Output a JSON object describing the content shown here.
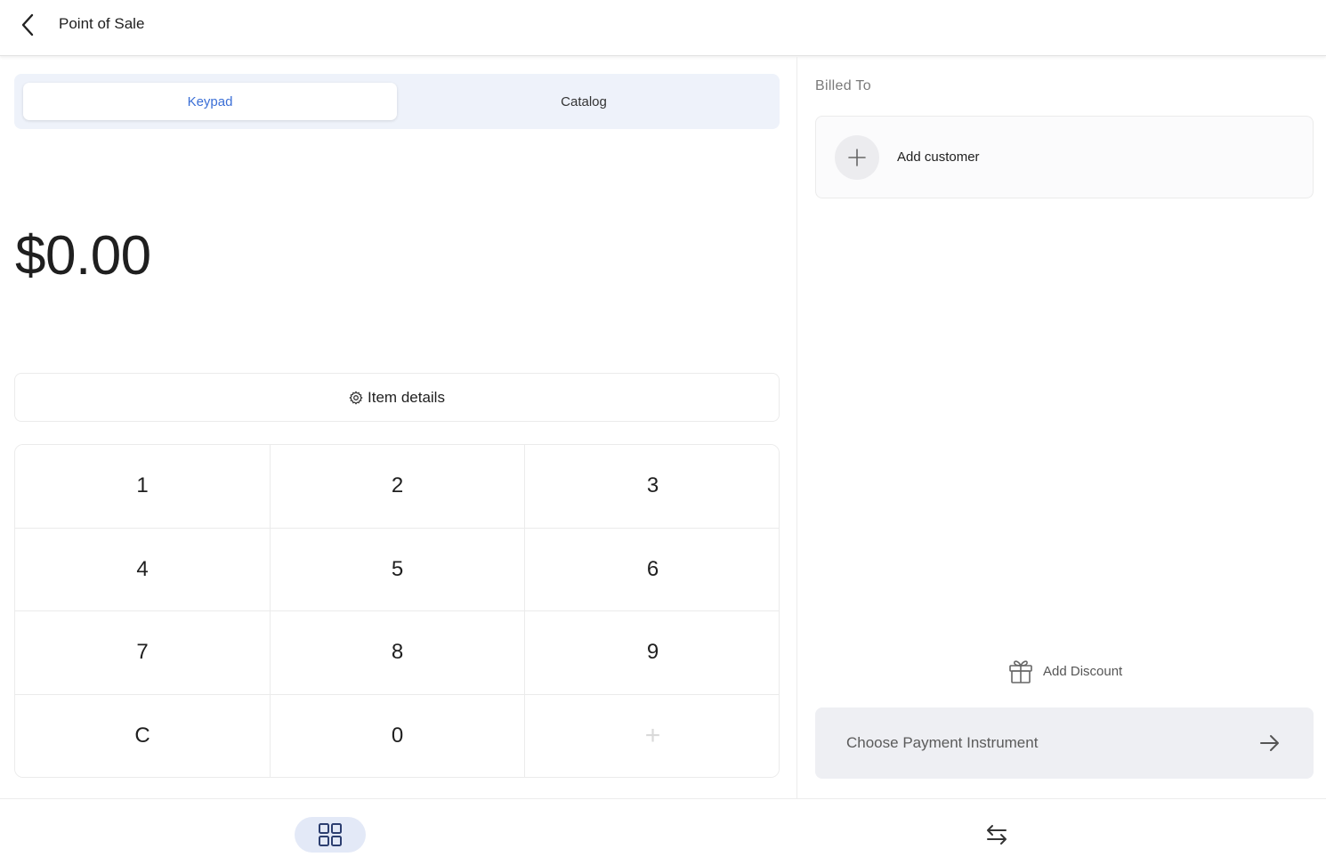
{
  "header": {
    "title": "Point of Sale",
    "back_icon": "chevron-left-icon"
  },
  "tabs": [
    {
      "label": "Keypad",
      "active": true
    },
    {
      "label": "Catalog",
      "active": false
    }
  ],
  "amount": "$0.00",
  "item_details": {
    "label": "Item details",
    "icon": "gear-icon"
  },
  "keypad": {
    "keys": [
      "1",
      "2",
      "3",
      "4",
      "5",
      "6",
      "7",
      "8",
      "9",
      "C",
      "0",
      "+"
    ]
  },
  "billing": {
    "label": "Billed To",
    "add_customer": "Add customer",
    "add_customer_icon": "plus-icon"
  },
  "discount": {
    "label": "Add Discount",
    "icon": "gift-icon"
  },
  "payment": {
    "label": "Choose Payment Instrument",
    "icon": "arrow-right-icon"
  },
  "bottom_nav": [
    {
      "icon": "grid-icon",
      "active": true
    },
    {
      "icon": "swap-arrows-icon",
      "active": false
    }
  ],
  "colors": {
    "accent": "#3b6fd6",
    "tabs_background": "#eef2fa",
    "payment_button": "#eeeff3",
    "nav_active": "#e3e9f7",
    "nav_icon": "#2c3e70"
  }
}
